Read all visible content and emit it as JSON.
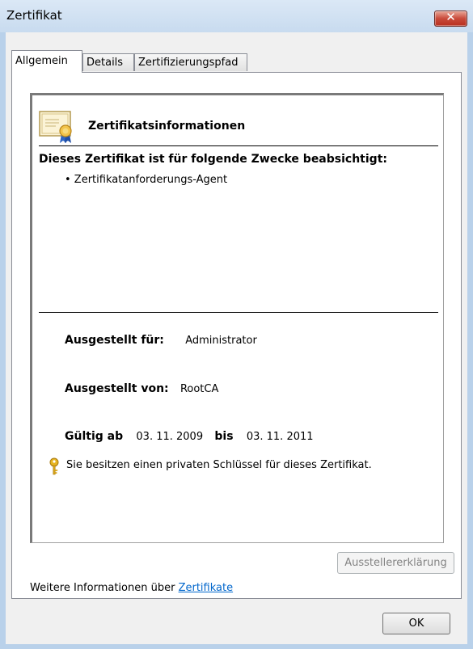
{
  "window": {
    "title": "Zertifikat"
  },
  "tabs": [
    "Allgemein",
    "Details",
    "Zertifizierungspfad"
  ],
  "info": {
    "title": "Zertifikatsinformationen",
    "purpose_heading": "Dieses Zertifikat ist für folgende Zwecke beabsichtigt:",
    "purposes": [
      "• Zertifikatanforderungs-Agent"
    ],
    "issued_to_label": "Ausgestellt für:",
    "issued_to_value": "Administrator",
    "issued_by_label": "Ausgestellt von:",
    "issued_by_value": "RootCA",
    "valid_from_label": "Gültig ab",
    "valid_from_value": "03. 11. 2009",
    "valid_to_label": "bis",
    "valid_to_value": "03. 11. 2011",
    "private_key_note": "Sie besitzen einen privaten Schlüssel für dieses Zertifikat."
  },
  "buttons": {
    "issuer_statement": "Ausstellererklärung",
    "ok": "OK"
  },
  "more_info": {
    "text": "Weitere Informationen über ",
    "link": "Zertifikate"
  },
  "icons": {
    "certificate": "certificate-icon",
    "key": "key-icon",
    "close": "close-icon"
  },
  "colors": {
    "link": "#0066cc",
    "close_button": "#c94a3a",
    "titlebar": "#c8dbef"
  }
}
